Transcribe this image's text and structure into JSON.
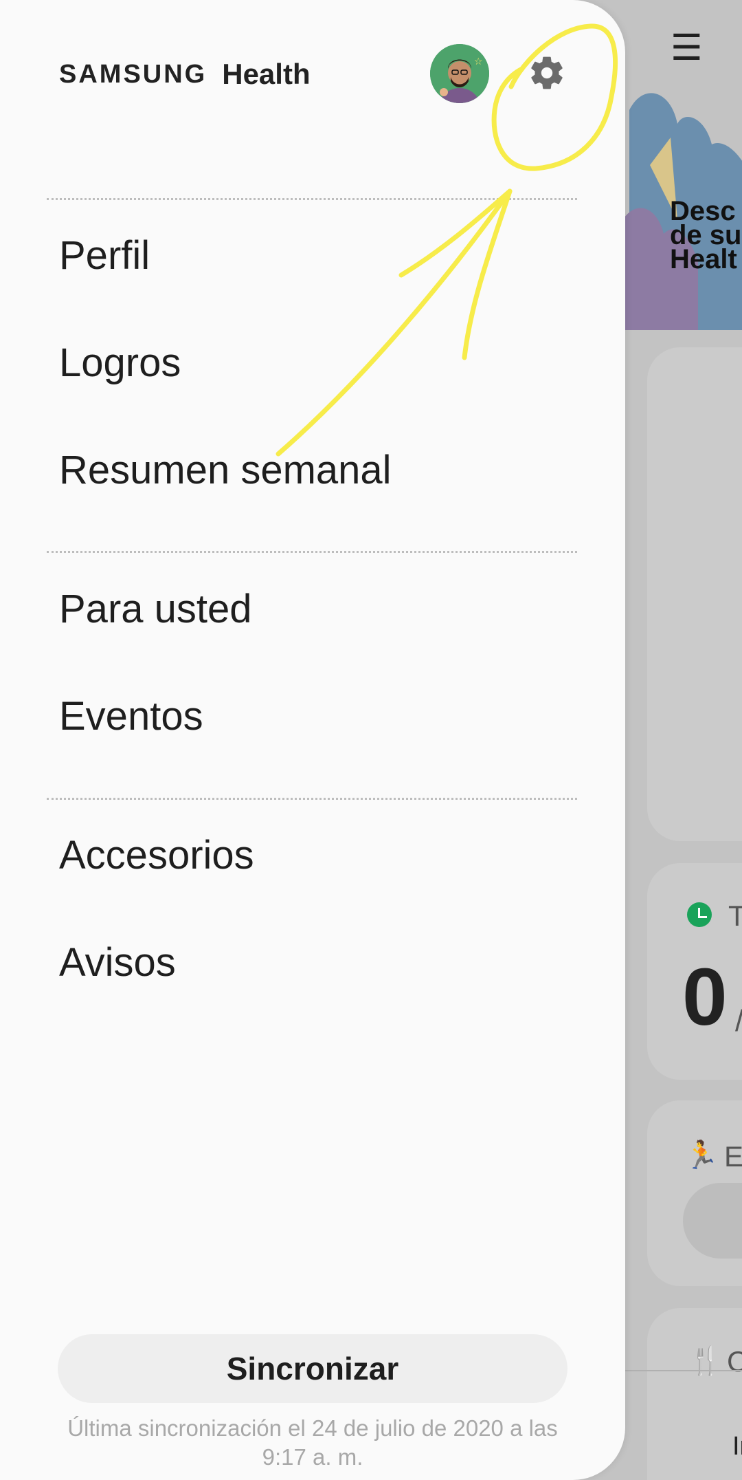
{
  "background": {
    "banner_title": "Desc\nde su\nHealt",
    "card2_label_fragment": "T",
    "card2_value": "0",
    "card2_unit_fragment": "/",
    "card3_label_fragment": "Ej",
    "card4_label_fragment": "C",
    "nav_fragment": "In"
  },
  "drawer": {
    "brand_samsung": "SAMSUNG",
    "brand_health": "Health",
    "menu_items": [
      {
        "label": "Perfil"
      },
      {
        "label": "Logros"
      },
      {
        "label": "Resumen semanal"
      },
      {
        "label": "Para usted"
      },
      {
        "label": "Eventos"
      },
      {
        "label": "Accesorios"
      },
      {
        "label": "Avisos"
      }
    ],
    "sync_button": "Sincronizar",
    "sync_info": "Última sincronización el 24 de julio de 2020 a las 9:17 a. m."
  },
  "colors": {
    "accent_green": "#1aa35a",
    "annotation_yellow": "#f7ec4a",
    "drawer_bg": "#fafafa"
  },
  "icons": {
    "settings": "gear-icon",
    "menu": "hamburger-icon",
    "avatar": "avatar"
  }
}
